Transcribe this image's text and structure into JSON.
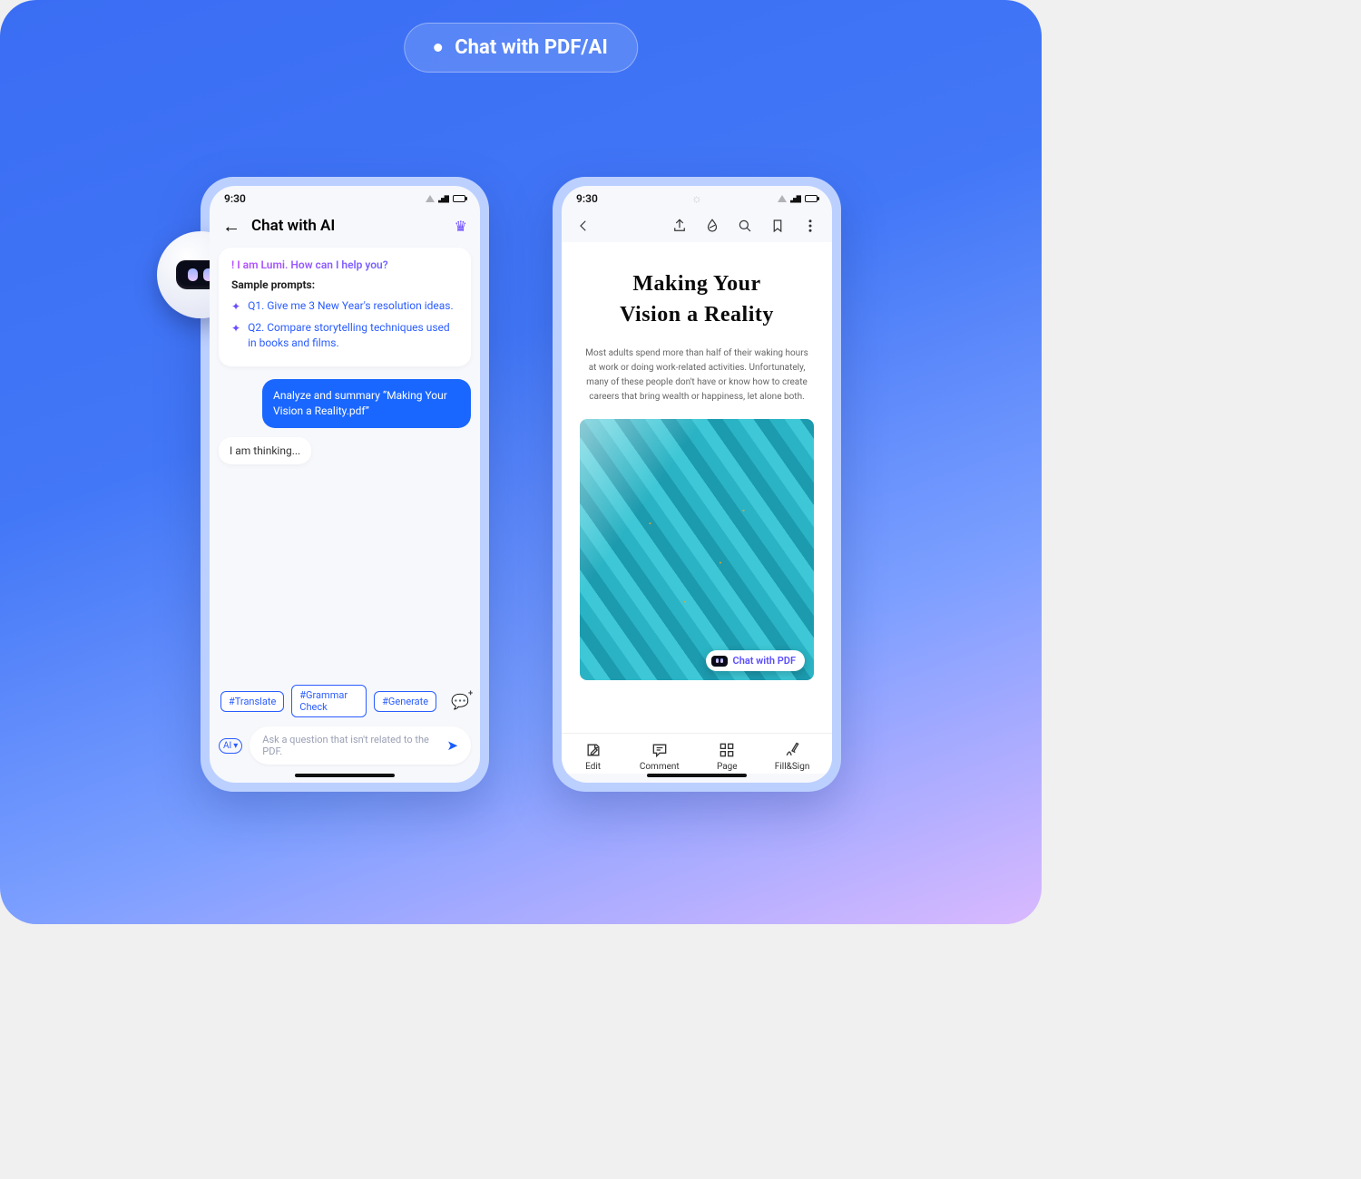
{
  "badge": {
    "label": "Chat with PDF/AI"
  },
  "status": {
    "time": "9:30"
  },
  "chat": {
    "title": "Chat with AI",
    "greeting": "! I am Lumi. How can I help you?",
    "sample_title": "Sample prompts:",
    "prompts": [
      "Q1. Give me 3 New Year's resolution ideas.",
      "Q2. Compare storytelling techniques used in books and films."
    ],
    "user_msg": "Analyze and summary  “Making Your Vision a Reality.pdf”",
    "thinking": "I  am thinking...",
    "chips": [
      "#Translate",
      "#Grammar Check",
      "#Generate"
    ],
    "input_placeholder": "Ask a question that isn't related to the PDF.",
    "ai_toggle": "AI"
  },
  "pdf": {
    "title_line1": "Making Your",
    "title_line2": "Vision a Reality",
    "paragraph": "Most adults spend more than half of their waking hours at work or doing work-related activities. Unfortunately, many of these people don't have or know how to create careers that bring wealth or happiness, let alone both.",
    "float_label": "Chat with PDF",
    "tabs": {
      "edit": "Edit",
      "comment": "Comment",
      "page": "Page",
      "fillsign": "Fill&Sign"
    }
  }
}
